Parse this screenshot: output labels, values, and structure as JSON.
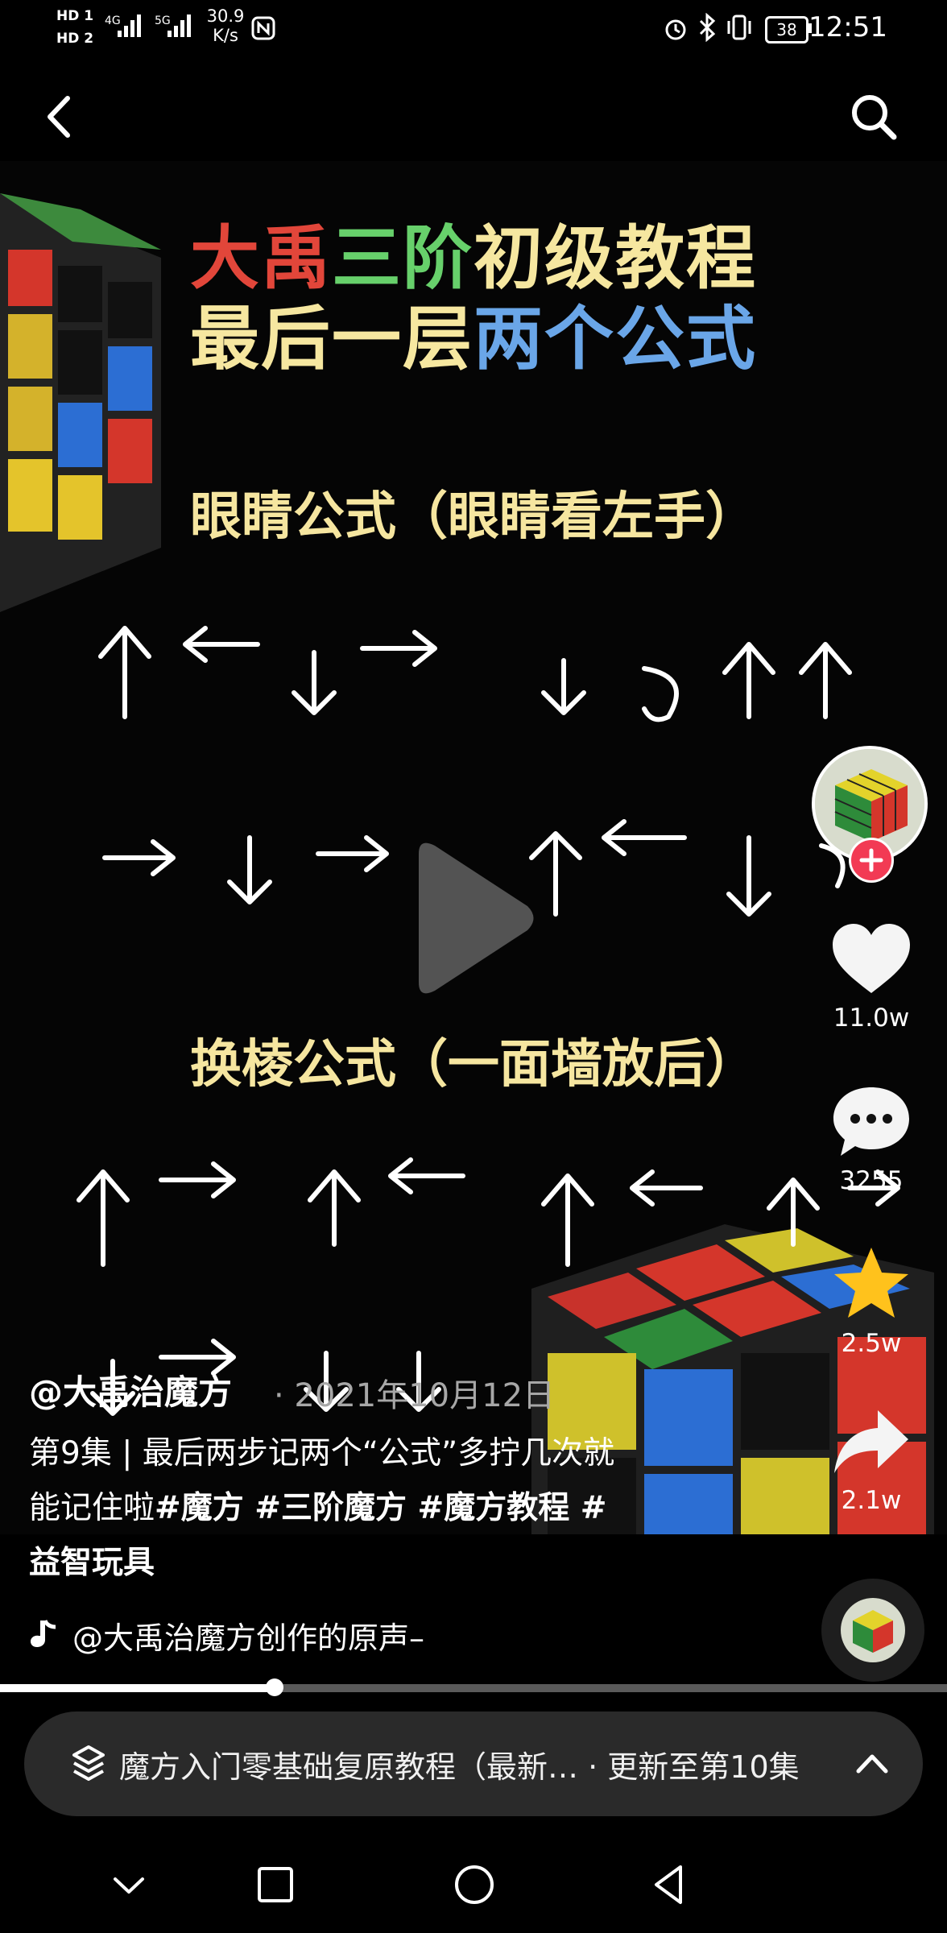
{
  "status_bar": {
    "hd1": "HD 1",
    "hd2": "HD 2",
    "net1": "4G",
    "net2": "5G",
    "speed_value": "30.9",
    "speed_unit": "K/s",
    "battery": "38",
    "time": "12:51"
  },
  "video": {
    "title_line1": [
      "大禹",
      "三阶",
      "初级教程"
    ],
    "title_line2": [
      "最后一层",
      "两个公式"
    ],
    "title_colors": {
      "red": "#e2463a",
      "green": "#67d06b",
      "yellow": "#f6e7a0",
      "blue": "#6aa6e8"
    },
    "section1": "眼睛公式（眼睛看左手）",
    "section2": "换棱公式（一面墙放后）"
  },
  "rail": {
    "likes": "11.0w",
    "comments": "3255",
    "favorites": "2.5w",
    "shares": "2.1w",
    "like_color": "#ffffff",
    "star_color": "#ffc21c",
    "follow_color": "#f23a54"
  },
  "caption": {
    "author": "@大禹治魔方",
    "date": "· 2021年10月12日",
    "line1": "第9集 | 最后两步记两个“公式”多拧几次就",
    "line2_plain": "能记住啦",
    "line2_tags": "#魔方 #三阶魔方 #魔方教程 #",
    "line3_tags": "益智玩具",
    "music": "@大禹治魔方创作的原声–"
  },
  "progress": {
    "fraction": 0.29
  },
  "series": {
    "title": "魔方入门零基础复原教程（最新…",
    "update": "· 更新至第10集"
  }
}
